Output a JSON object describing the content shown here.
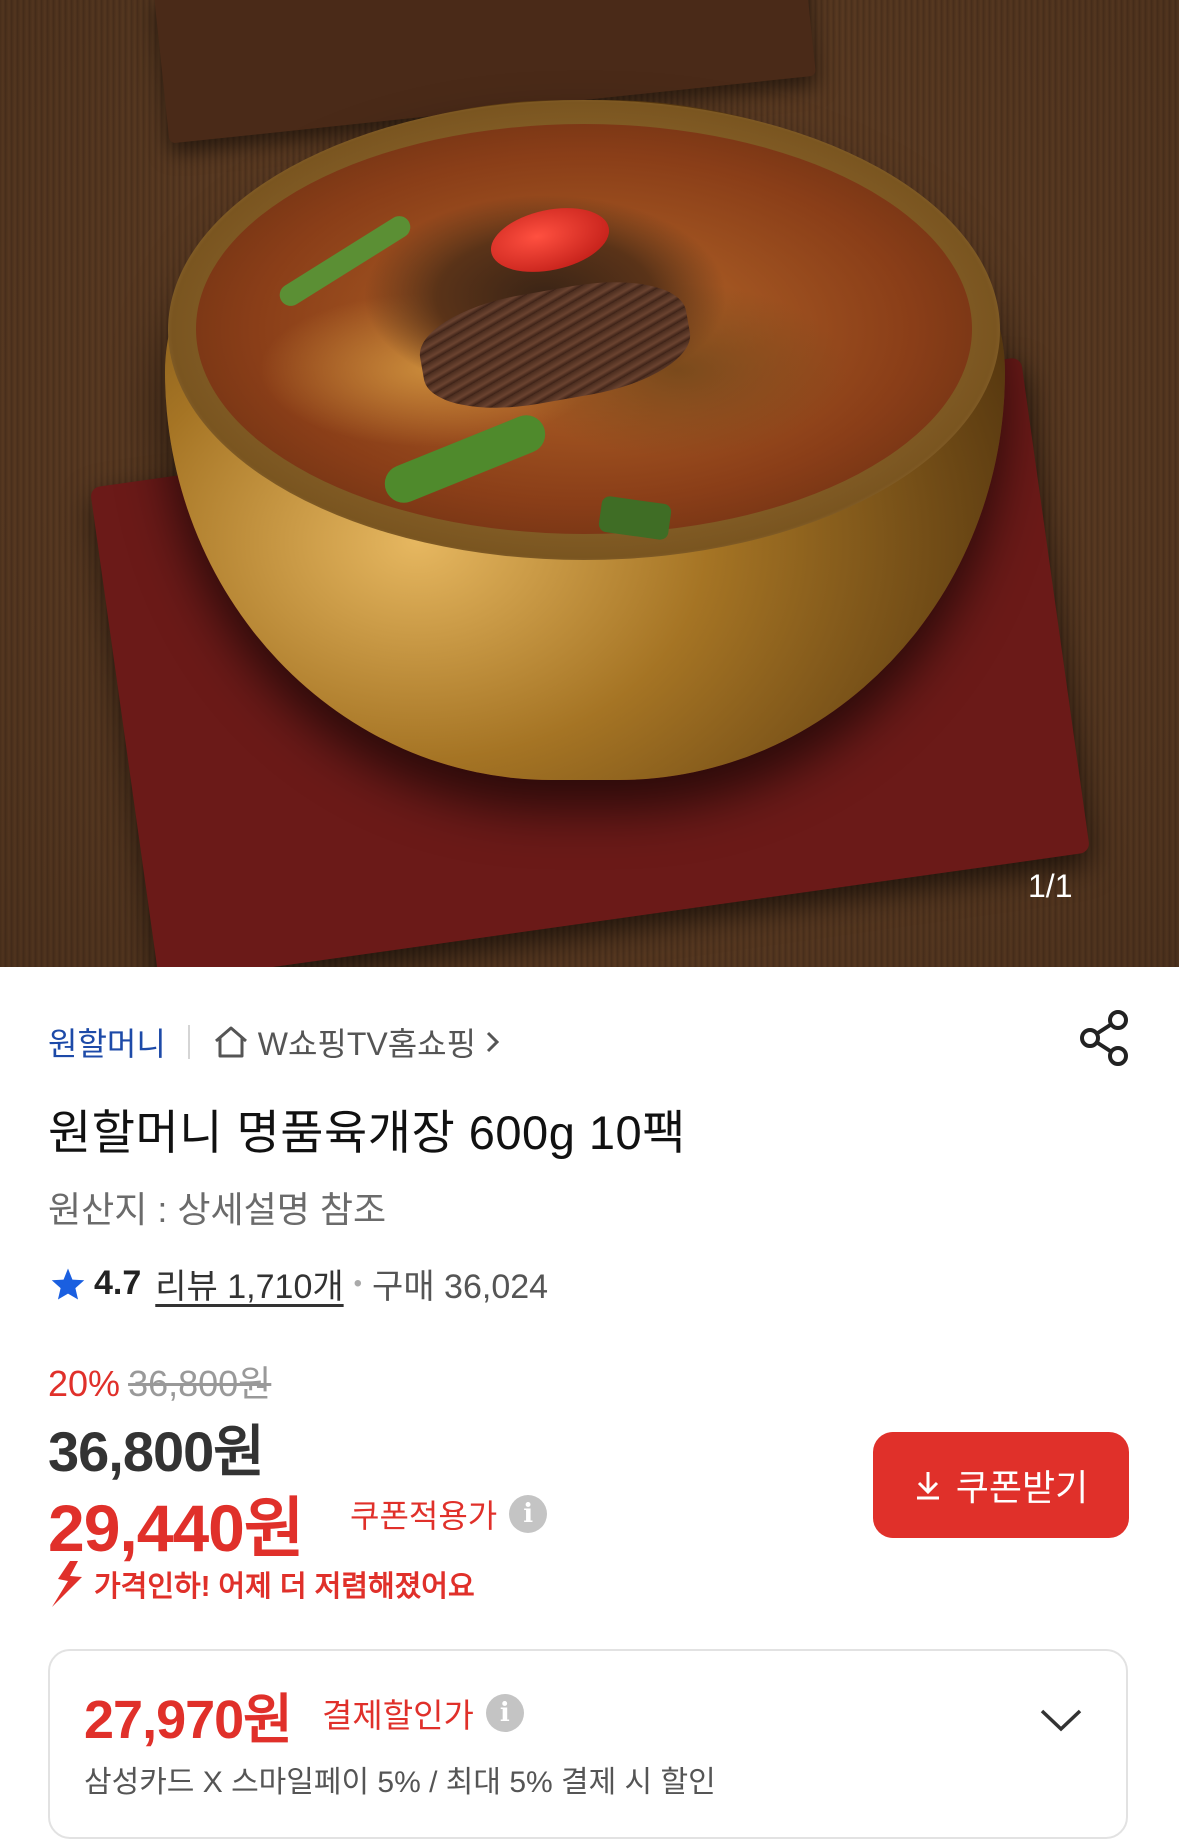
{
  "hero": {
    "image_counter": "1/1"
  },
  "store": {
    "brand": "원할머니",
    "shop_name": "W쇼핑TV홈쇼핑"
  },
  "product": {
    "title": "원할머니 명품육개장 600g 10팩",
    "origin": "원산지 : 상세설명 참조",
    "rating": "4.7",
    "review_text": "리뷰 1,710개",
    "purchase_text": "구매 36,024"
  },
  "price": {
    "discount_pct": "20%",
    "original": "36,800원",
    "main": "36,800원",
    "coupon_price": "29,440원",
    "coupon_label": "쿠폰적용가",
    "coupon_button": "쿠폰받기",
    "drop_notice": "가격인하! 어제 더 저렴해졌어요"
  },
  "payment": {
    "price": "27,970원",
    "label": "결제할인가",
    "detail": "삼성카드 X 스마일페이 5%  / 최대 5% 결제 시 할인"
  },
  "colors": {
    "accent_red": "#e0302a",
    "brand_blue": "#1d4aa8"
  },
  "icons": [
    "home-icon",
    "chevron-right-icon",
    "share-icon",
    "star-icon",
    "info-icon",
    "download-icon",
    "price-drop-icon",
    "chevron-down-icon"
  ]
}
